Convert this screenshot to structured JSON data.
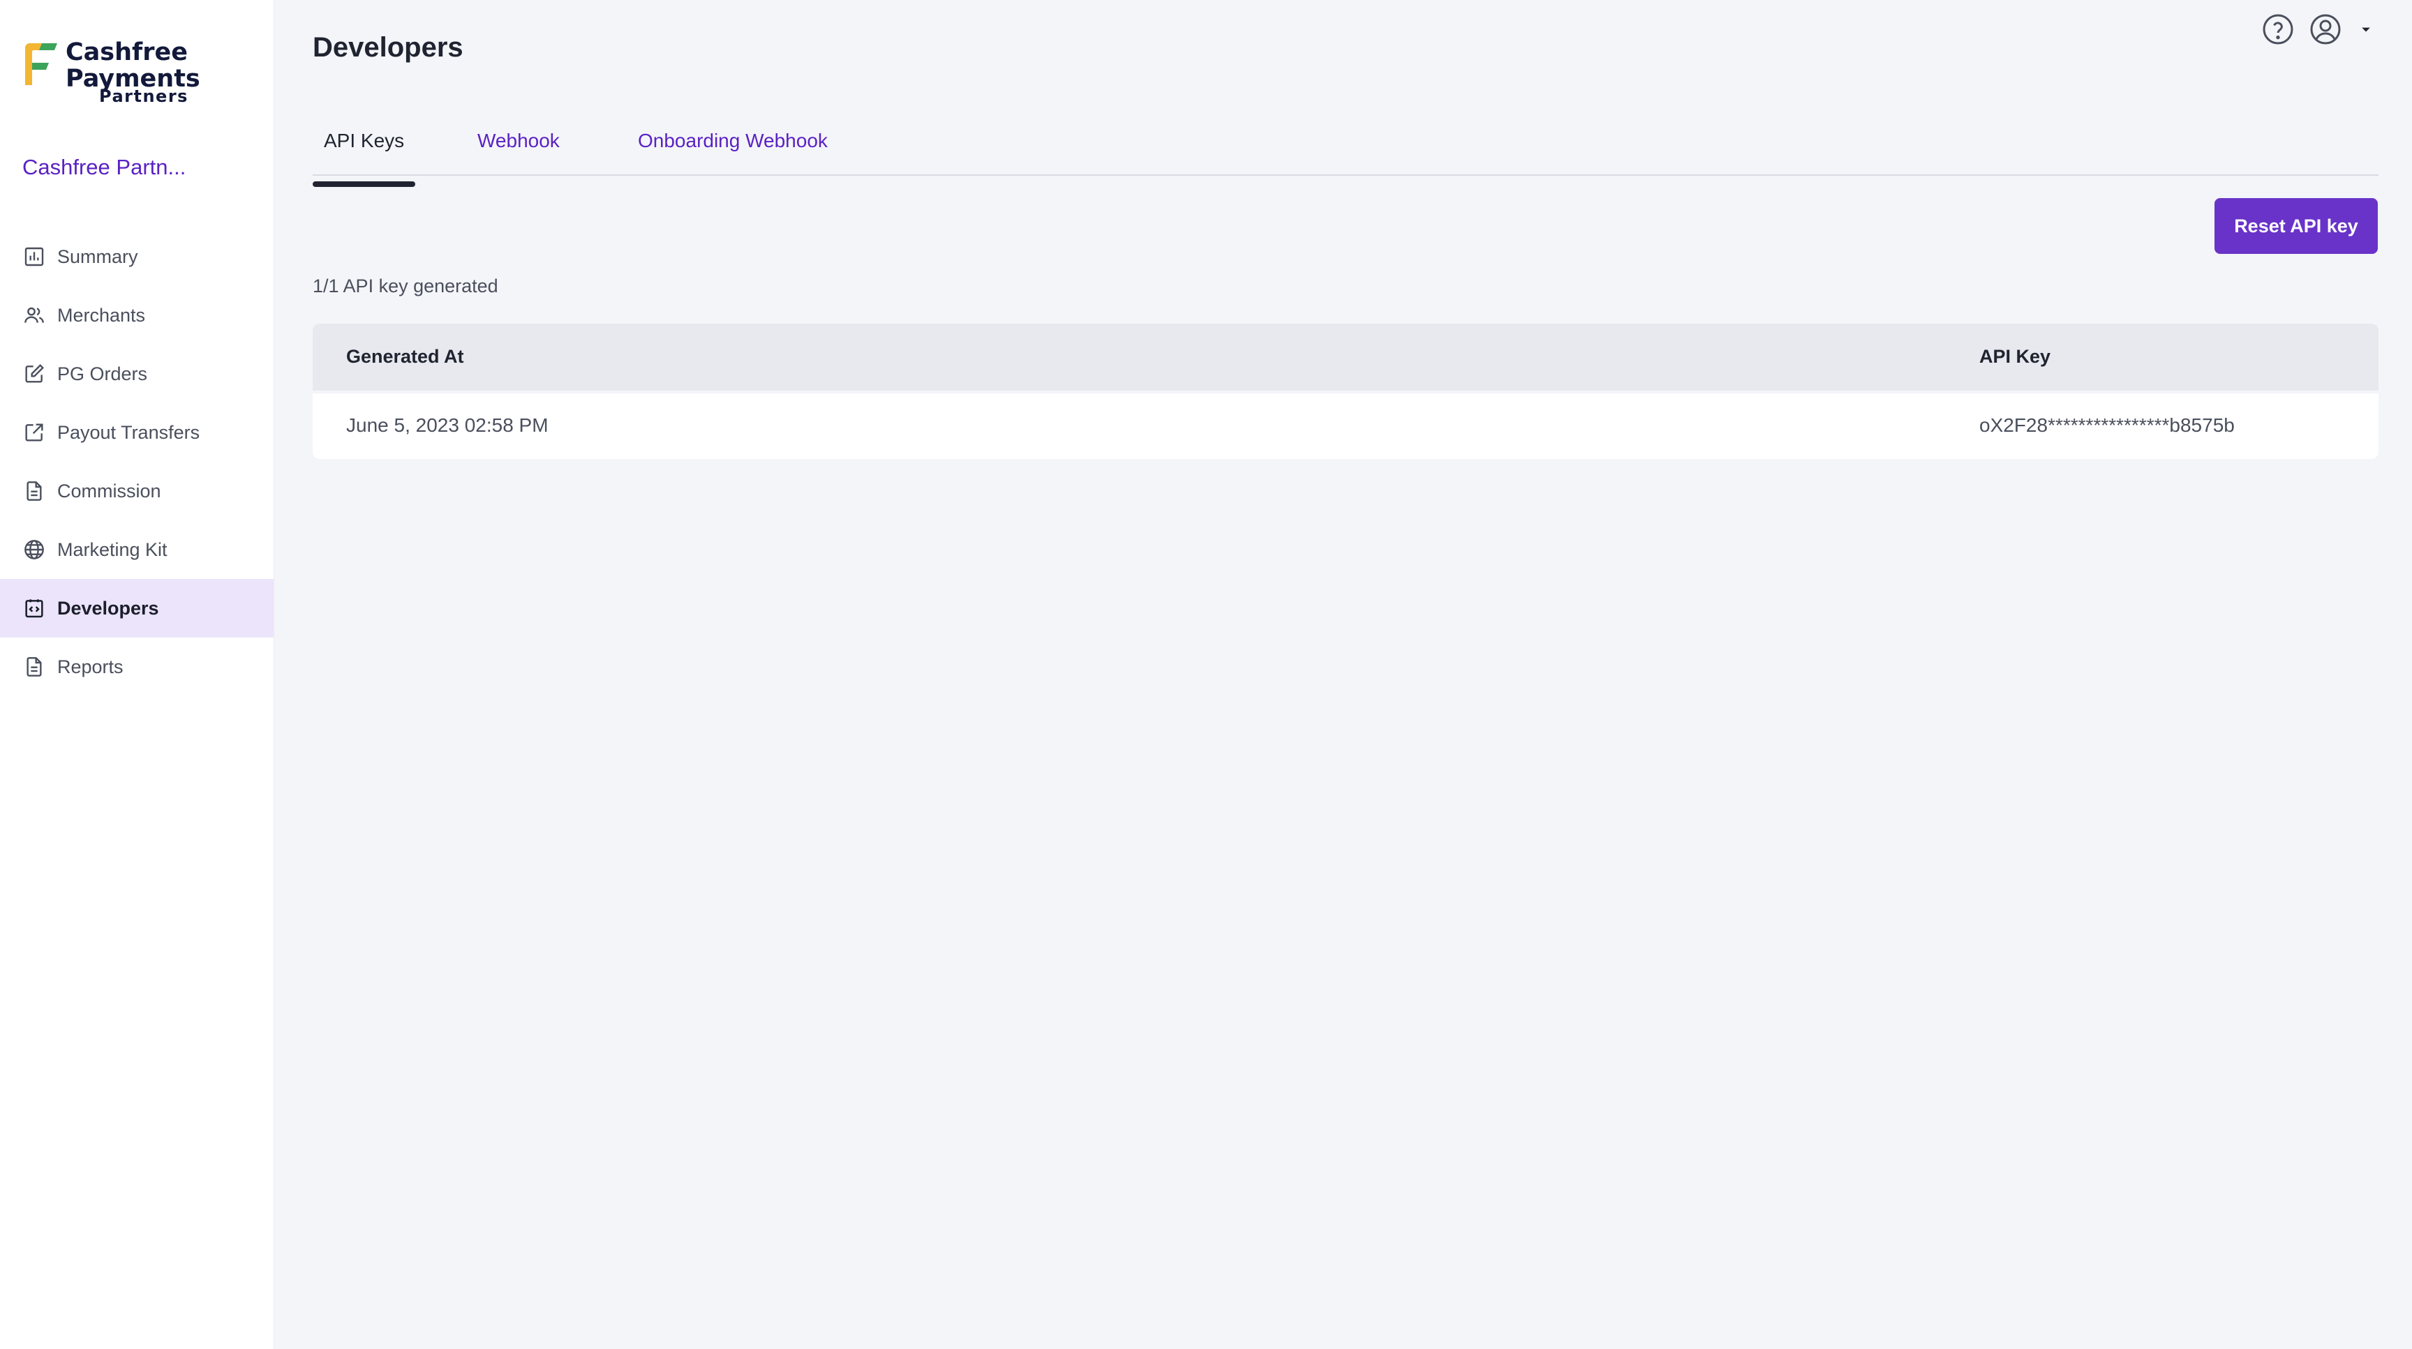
{
  "brand": {
    "line1": "Cashfree",
    "line2": "Payments",
    "sub": "Partners",
    "account_name": "Cashfree Partn..."
  },
  "sidebar": {
    "items": [
      {
        "label": "Summary",
        "icon": "bar-chart-icon"
      },
      {
        "label": "Merchants",
        "icon": "users-icon"
      },
      {
        "label": "PG Orders",
        "icon": "edit-square-icon"
      },
      {
        "label": "Payout Transfers",
        "icon": "external-link-square-icon"
      },
      {
        "label": "Commission",
        "icon": "document-icon"
      },
      {
        "label": "Marketing Kit",
        "icon": "globe-icon"
      },
      {
        "label": "Developers",
        "icon": "code-square-icon",
        "active": true
      },
      {
        "label": "Reports",
        "icon": "document-icon"
      }
    ]
  },
  "header": {
    "title": "Developers",
    "help_icon": "help-circle-icon",
    "user_icon": "user-circle-icon",
    "dropdown_icon": "caret-down-icon"
  },
  "tabs": [
    {
      "label": "API Keys",
      "active": true
    },
    {
      "label": "Webhook"
    },
    {
      "label": "Onboarding Webhook"
    }
  ],
  "actions": {
    "reset_label": "Reset API key"
  },
  "api_keys": {
    "count_text": "1/1 API key generated",
    "columns": [
      "Generated At",
      "API Key"
    ],
    "rows": [
      {
        "generated_at": "June 5, 2023 02:58 PM",
        "api_key": "oX2F28****************b8575b"
      }
    ]
  },
  "colors": {
    "accent": "#6933c9",
    "link": "#5a22c4",
    "active_bg": "#ece4fb",
    "page_bg": "#f4f5f9"
  }
}
